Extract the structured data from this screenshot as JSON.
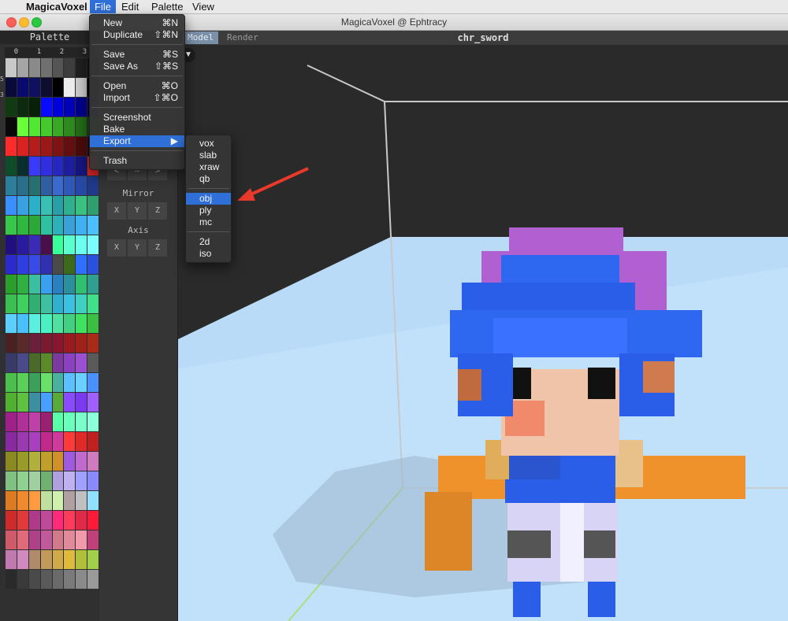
{
  "menubar": {
    "apple_icon": "",
    "app_name": "MagicaVoxel",
    "items": [
      "File",
      "Edit",
      "Palette",
      "View"
    ]
  },
  "window": {
    "title": "MagicaVoxel @ Ephtracy"
  },
  "palette": {
    "title": "Palette",
    "tabs": [
      "0",
      "1",
      "2",
      "3"
    ],
    "side_tabs": [
      "5",
      "3"
    ],
    "rows": [
      [
        "#c8c8c8",
        "#a5a5a5",
        "#8a8a8a",
        "#707070",
        "#555555",
        "#3d3d3d",
        "#1f1f1f",
        "#111111"
      ],
      [
        "#0a0a3a",
        "#0a0a6e",
        "#101060",
        "#0d0d30",
        "#000000",
        "#ececec",
        "#c8c8c8",
        "#000000"
      ],
      [
        "#103b10",
        "#0c2a0c",
        "#081f08",
        "#0a0aff",
        "#0000dd",
        "#0000b8",
        "#00008a",
        "#000060"
      ],
      [
        "#090909",
        "#6aff3a",
        "#52e832",
        "#45c92d",
        "#3aa825",
        "#2f8a1e",
        "#236b17",
        "#184d10"
      ],
      [
        "#ff2a2a",
        "#d92323",
        "#b51d1d",
        "#9a1818",
        "#7e1313",
        "#640f0f",
        "#4a0b0b",
        "#300606"
      ],
      [
        "#0d4d2a",
        "#0a2e2e",
        "#3a3aff",
        "#2f2fe0",
        "#2626c0",
        "#1d1da0",
        "#151580",
        "#e02626"
      ],
      [
        "#2a7f9a",
        "#2a6f8a",
        "#277070",
        "#2f5f9f",
        "#3a6acf",
        "#2f58b8",
        "#2848a5",
        "#20398a"
      ],
      [
        "#3a8fff",
        "#3aa0e0",
        "#2ab0c8",
        "#3ac0b0",
        "#2a9fa8",
        "#2fb08f",
        "#3ac07f",
        "#2f9f6f"
      ],
      [
        "#36c84a",
        "#2fb840",
        "#2aa838",
        "#30c0a0",
        "#2fb0b8",
        "#3aa0d8",
        "#3fb0f0",
        "#4ac0ff"
      ],
      [
        "#1f0f7f",
        "#2a1aa0",
        "#3a2ab8",
        "#4a0f4a",
        "#3aff9a",
        "#5affd0",
        "#6affef",
        "#7affff"
      ],
      [
        "#2a2acf",
        "#2f3fdf",
        "#3a4ae8",
        "#3030b0",
        "#4a4a4a",
        "#3a6a1a",
        "#3070ff",
        "#2a50e0"
      ],
      [
        "#2aa02a",
        "#30b040",
        "#3ac0a0",
        "#3aa0f0",
        "#2a80c0",
        "#2a90a0",
        "#30c070",
        "#2fa08f"
      ],
      [
        "#3ac050",
        "#40d060",
        "#30b070",
        "#3fc0a0",
        "#2fb0d0",
        "#3ac0e0",
        "#40d0c0",
        "#3fe08a"
      ],
      [
        "#5ad0ff",
        "#4ac0ff",
        "#5af0e0",
        "#4af0c0",
        "#50e0a0",
        "#40d080",
        "#40e060",
        "#3ac040"
      ],
      [
        "#4a2020",
        "#5a2a2a",
        "#6a1f3a",
        "#7a1a30",
        "#8a1530",
        "#9a1a20",
        "#a0201a",
        "#aa2a1a"
      ],
      [
        "#3a3a6a",
        "#4a4a8a",
        "#4a6a2a",
        "#5a8a2a",
        "#7a3aa0",
        "#8a40c0",
        "#9a50d0",
        "#5a5a5a"
      ],
      [
        "#4ac04a",
        "#5ad05a",
        "#3aa05a",
        "#6ae06a",
        "#4ab0a0",
        "#5ac0ff",
        "#6ad0ff",
        "#4a90ff"
      ],
      [
        "#50b030",
        "#60c040",
        "#3a90a0",
        "#4aa0ff",
        "#5aaa3a",
        "#8a4aff",
        "#7a3aef",
        "#a060ff"
      ],
      [
        "#a0208a",
        "#b0309a",
        "#c040aa",
        "#9a2070",
        "#5affaa",
        "#6affba",
        "#7affca",
        "#8affda"
      ],
      [
        "#8a2aa0",
        "#9a3ab0",
        "#aa40c0",
        "#c02a8a",
        "#d03a9a",
        "#ff3a3a",
        "#e02a2a",
        "#c02020"
      ],
      [
        "#8a8a20",
        "#9a9a2a",
        "#b0b03a",
        "#c0a02a",
        "#d0902a",
        "#a05ae0",
        "#c06ad0",
        "#d07ac0"
      ],
      [
        "#80c080",
        "#90d090",
        "#a0d0a0",
        "#70b070",
        "#b0a0e0",
        "#c0b0f0",
        "#a0a0ff",
        "#8a8aff"
      ],
      [
        "#e07a20",
        "#f08a30",
        "#ff9a40",
        "#c0e0a0",
        "#d0f0b0",
        "#b0a0a0",
        "#c0c0c0",
        "#90e0ff"
      ],
      [
        "#d02a2a",
        "#e03a3a",
        "#b03a8a",
        "#c04a9a",
        "#ff2a7a",
        "#ff3a5a",
        "#e02a4a",
        "#ff1a3a"
      ],
      [
        "#d05a6a",
        "#e06a7a",
        "#b0408a",
        "#c05a9a",
        "#d07a8a",
        "#e08a9a",
        "#f09aaa",
        "#c0407a"
      ],
      [
        "#c07ab0",
        "#d08ac0",
        "#b08a6a",
        "#c09a5a",
        "#d0aa4a",
        "#e0ba3a",
        "#b0c03a",
        "#a0d04a"
      ],
      [
        "#2a2a2a",
        "#3a3a3a",
        "#4a4a4a",
        "#5a5a5a",
        "#6a6a6a",
        "#7a7a7a",
        "#8a8a8a",
        "#9a9a9a"
      ]
    ]
  },
  "tool_panel": {
    "mirror_label": "Mirror",
    "axis_label": "Axis",
    "xyz": [
      "X",
      "Y",
      "Z"
    ],
    "stepper": [
      "<",
      "—",
      ">"
    ]
  },
  "viewport": {
    "mode_tabs": [
      "Model",
      "Render"
    ],
    "active_mode": "Model",
    "file_name": "chr_sword",
    "dropdown_glyph": "▼"
  },
  "file_menu": {
    "items": [
      {
        "label": "New",
        "shortcut": "⌘N"
      },
      {
        "label": "Duplicate",
        "shortcut": "⇧⌘N"
      },
      {
        "sep": true
      },
      {
        "label": "Save",
        "shortcut": "⌘S"
      },
      {
        "label": "Save As",
        "shortcut": "⇧⌘S"
      },
      {
        "sep": true
      },
      {
        "label": "Open",
        "shortcut": "⌘O"
      },
      {
        "label": "Import",
        "shortcut": "⇧⌘O"
      },
      {
        "sep": true
      },
      {
        "label": "Screenshot",
        "shortcut": ""
      },
      {
        "label": "Bake",
        "shortcut": ""
      },
      {
        "label": "Export",
        "shortcut": "▶",
        "highlighted": true
      },
      {
        "sep": true
      },
      {
        "label": "Trash",
        "shortcut": ""
      }
    ]
  },
  "export_menu": {
    "items": [
      {
        "label": "vox"
      },
      {
        "label": "slab"
      },
      {
        "label": "xraw"
      },
      {
        "label": "qb"
      },
      {
        "sep": true
      },
      {
        "label": "obj",
        "highlighted": true
      },
      {
        "label": "ply"
      },
      {
        "label": "mc"
      },
      {
        "sep": true
      },
      {
        "label": "2d"
      },
      {
        "label": "iso"
      }
    ]
  },
  "colors": {
    "accent": "#2f6fd8",
    "annotation_arrow": "#e8392b",
    "floor": "#bfe0fb",
    "character_blue": "#2a5ee8",
    "character_hair": "#b060d0",
    "sword": "#f0922c"
  }
}
